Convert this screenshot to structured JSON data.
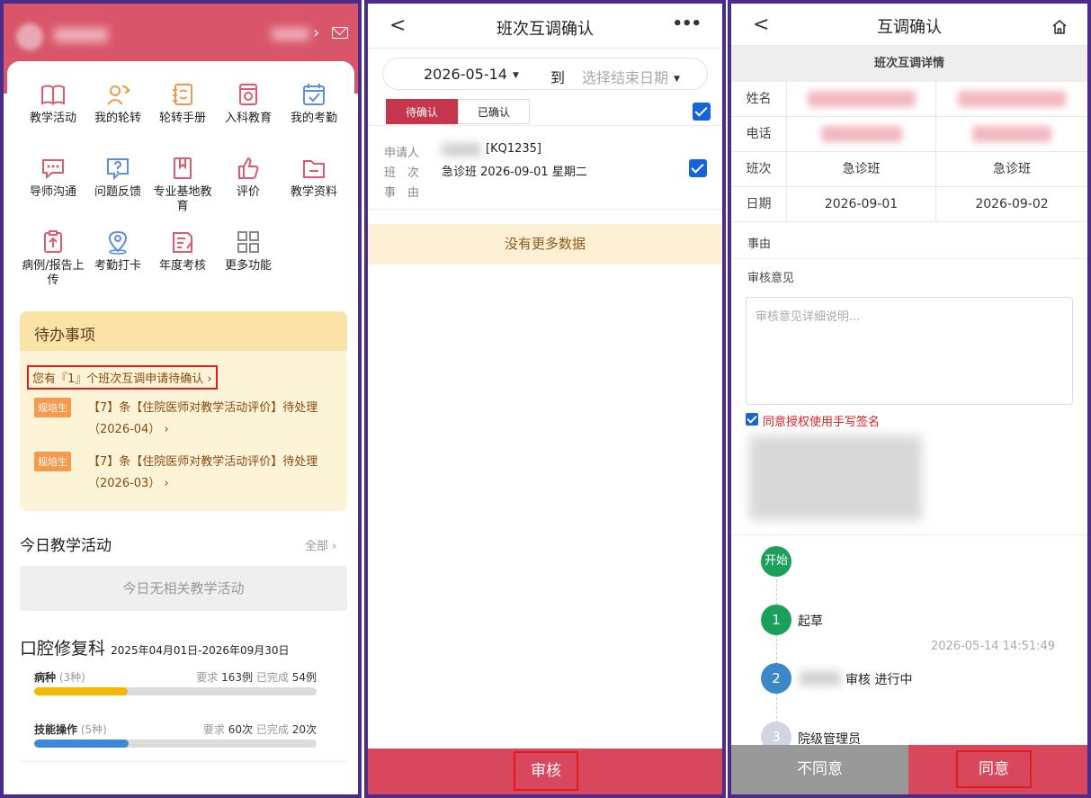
{
  "panel1": {
    "grid": [
      {
        "label": "教学活动",
        "icon": "book-icon"
      },
      {
        "label": "我的轮转",
        "icon": "user-rotate-icon"
      },
      {
        "label": "轮转手册",
        "icon": "notebook-icon"
      },
      {
        "label": "入科教育",
        "icon": "flower-card-icon"
      },
      {
        "label": "我的考勤",
        "icon": "calendar-check-icon"
      },
      {
        "label": "导师沟通",
        "icon": "chat-icon"
      },
      {
        "label": "问题反馈",
        "icon": "question-icon"
      },
      {
        "label": "专业基地教育",
        "icon": "bookmark-book-icon"
      },
      {
        "label": "评价",
        "icon": "thumb-up-icon"
      },
      {
        "label": "教学资料",
        "icon": "folder-icon"
      },
      {
        "label": "病例/报告上传",
        "icon": "clipboard-upload-icon"
      },
      {
        "label": "考勤打卡",
        "icon": "location-pin-icon"
      },
      {
        "label": "年度考核",
        "icon": "annual-exam-icon"
      },
      {
        "label": "更多功能",
        "icon": "grid-more-icon"
      }
    ],
    "todo": {
      "title": "待办事项",
      "first": "您有『1』个班次互调申请待确认",
      "items": [
        {
          "tag": "规培生",
          "text": "【7】条【住院医师对教学活动评价】待处理",
          "sub": "（2026-04）"
        },
        {
          "tag": "规培生",
          "text": "【7】条【住院医师对教学活动评价】待处理",
          "sub": "（2026-03）"
        }
      ]
    },
    "today": {
      "title": "今日教学活动",
      "more": "全部",
      "empty": "今日无相关教学活动"
    },
    "dept": {
      "name": "口腔修复科",
      "range": "2025年04月01日-2026年09月30日",
      "progress": [
        {
          "name": "病种",
          "count": "(3种)",
          "req_label": "要求",
          "req": "163例",
          "done_label": "已完成",
          "done": "54例",
          "ratio": 0.331,
          "color": "#f5b800"
        },
        {
          "name": "技能操作",
          "count": "(5种)",
          "req_label": "要求",
          "req": "60次",
          "done_label": "已完成",
          "done": "20次",
          "ratio": 0.333,
          "color": "#3b8ad9"
        }
      ]
    }
  },
  "panel2": {
    "title": "班次互调确认",
    "back": "<",
    "more": "•••",
    "date_start": "2026-05-14",
    "date_to": "到",
    "date_end_placeholder": "选择结束日期",
    "tabs": [
      "待确认",
      "已确认"
    ],
    "fields": [
      {
        "label": "申请人",
        "value": "[KQ1235]"
      },
      {
        "label": "班　次",
        "value": "急诊班  2026-09-01 星期二"
      },
      {
        "label": "事　由",
        "value": ""
      }
    ],
    "no_more": "没有更多数据",
    "action": "审核"
  },
  "panel3": {
    "title": "互调确认",
    "back": "<",
    "detail_title": "班次互调详情",
    "rows": [
      {
        "label": "姓名",
        "c1": "",
        "c2": ""
      },
      {
        "label": "电话",
        "c1": "",
        "c2": ""
      },
      {
        "label": "班次",
        "c1": "急诊班",
        "c2": "急诊班"
      },
      {
        "label": "日期",
        "c1": "2026-09-01",
        "c2": "2026-09-02"
      }
    ],
    "reason_label": "事由",
    "opinion_label": "审核意见",
    "opinion_placeholder": "审核意见详细说明...",
    "sign_label": "同意授权使用手写签名",
    "flow": {
      "start": "开始",
      "steps": [
        {
          "num": "1",
          "label": "起草",
          "color": "#1aa05a"
        },
        {
          "num": "2",
          "label": "审核 进行中",
          "color": "#3a88c8"
        },
        {
          "num": "3",
          "label": "院级管理员",
          "color": "#cfd6e0"
        }
      ],
      "time": "2026-05-14 14:51:49"
    },
    "disagree": "不同意",
    "agree": "同意"
  }
}
